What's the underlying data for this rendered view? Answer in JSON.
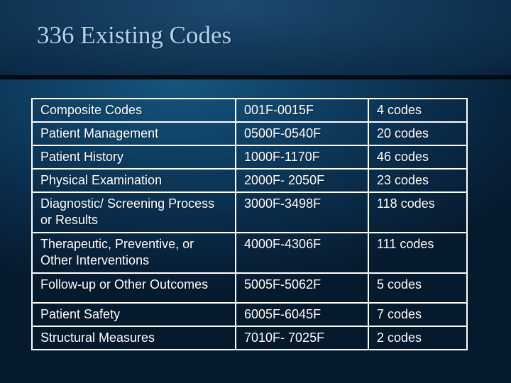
{
  "slide": {
    "title": "336 Existing Codes"
  },
  "table": {
    "rows": [
      {
        "category": "Composite Codes",
        "range": "001F-0015F",
        "count": "4 codes"
      },
      {
        "category": "Patient Management",
        "range": "0500F-0540F",
        "count": "20 codes"
      },
      {
        "category": "Patient History",
        "range": "1000F-1170F",
        "count": "46 codes"
      },
      {
        "category": "Physical Examination",
        "range": "2000F- 2050F",
        "count": "23 codes"
      },
      {
        "category": "Diagnostic/ Screening Process or Results",
        "range": "3000F-3498F",
        "count": "118 codes"
      },
      {
        "category": "Therapeutic, Preventive, or Other Interventions",
        "range": "4000F-4306F",
        "count": "111 codes"
      },
      {
        "category": "Follow-up or Other Outcomes",
        "range": "5005F-5062F",
        "count": "5 codes"
      },
      {
        "category": "Patient Safety",
        "range": "6005F-6045F",
        "count": "7 codes"
      },
      {
        "category": "Structural Measures",
        "range": "7010F- 7025F",
        "count": "2 codes"
      }
    ]
  },
  "colors": {
    "title": "#b3d3f0",
    "table_text": "#ffffff",
    "table_border": "#ffffff",
    "background": "#0b2540"
  }
}
